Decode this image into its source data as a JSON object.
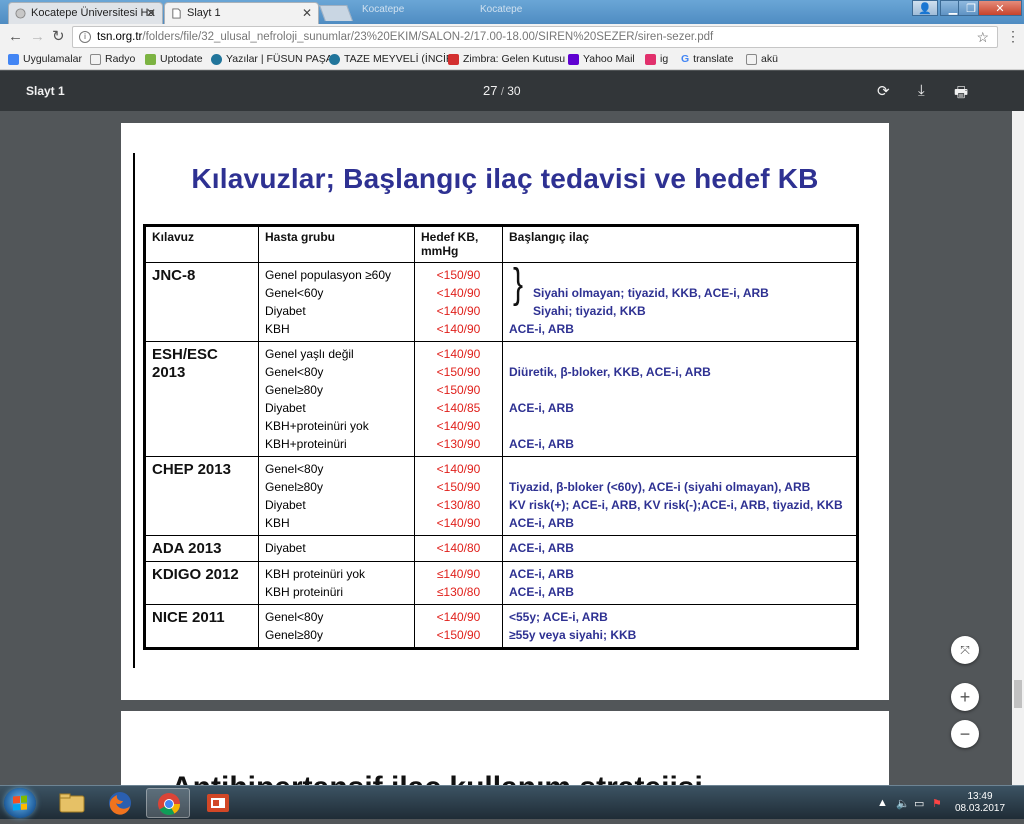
{
  "browser": {
    "tabs": [
      {
        "title": "Kocatepe Üniversitesi Ha",
        "active": false
      },
      {
        "title": "Slayt 1",
        "active": true
      }
    ],
    "blurred_tabs": [
      "Kocatepe",
      "Kocatepe"
    ],
    "url_host": "tsn.org.tr",
    "url_path": "/folders/file/32_ulusal_nefroloji_sunumlar/23%20EKIM/SALON-2/17.00-18.00/SIREN%20SEZER/siren-sezer.pdf",
    "bookmarks": [
      {
        "label": "Uygulamalar",
        "icon": "apps-grid-icon",
        "color": "#4285f4"
      },
      {
        "label": "Radyo",
        "icon": "page-icon",
        "color": "#888888"
      },
      {
        "label": "Uptodate",
        "icon": "uptodate-icon",
        "color": "#7cb342"
      },
      {
        "label": "Yazılar | FÜSUN PAŞA",
        "icon": "wordpress-icon",
        "color": "#21759b"
      },
      {
        "label": "TAZE MEYVELİ (İNCİR",
        "icon": "wordpress-icon",
        "color": "#21759b"
      },
      {
        "label": "Zimbra: Gelen Kutusu",
        "icon": "zimbra-icon",
        "color": "#d32f2f"
      },
      {
        "label": "Yahoo Mail",
        "icon": "yahoo-mail-icon",
        "color": "#5f01d1"
      },
      {
        "label": "ig",
        "icon": "instagram-icon",
        "color": "#e1306c"
      },
      {
        "label": "translate",
        "icon": "google-icon",
        "color": "#4285f4"
      },
      {
        "label": "akü",
        "icon": "page-icon",
        "color": "#888888"
      }
    ]
  },
  "pdf": {
    "title": "Slayt 1",
    "current_page": "27",
    "page_separator": "/",
    "total_pages": "30"
  },
  "slide": {
    "title": "Kılavuzlar; Başlangıç ilaç tedavisi ve hedef KB",
    "headers": [
      "Kılavuz",
      "Hasta grubu",
      "Hedef KB, mmHg",
      "Başlangıç ilaç"
    ],
    "groups": [
      {
        "name": [
          "JNC-8"
        ],
        "patients": [
          "Genel populasyon ≥60y",
          "Genel<60y",
          "Diyabet",
          "KBH"
        ],
        "targets": [
          "<150/90",
          "<140/90",
          "<140/90",
          "<140/90"
        ],
        "drugs": [
          "",
          "Siyahi olmayan; tiyazid, KKB, ACE-i, ARB",
          "Siyahi; tiyazid, KKB",
          "ACE-i, ARB"
        ]
      },
      {
        "name": [
          "ESH/ESC",
          "2013"
        ],
        "patients": [
          "Genel yaşlı değil",
          "Genel<80y",
          "Genel≥80y",
          "Diyabet",
          "KBH+proteinüri yok",
          "KBH+proteinüri"
        ],
        "targets": [
          "<140/90",
          "<150/90",
          "<150/90",
          "<140/85",
          "<140/90",
          "<130/90"
        ],
        "drugs": [
          "",
          "Diüretik, β-bloker, KKB, ACE-i, ARB",
          "",
          "ACE-i, ARB",
          "",
          "ACE-i, ARB"
        ]
      },
      {
        "name": [
          "CHEP 2013"
        ],
        "patients": [
          "Genel<80y",
          "Genel≥80y",
          "Diyabet",
          "KBH"
        ],
        "targets": [
          "<140/90",
          "<150/90",
          "<130/80",
          "<140/90"
        ],
        "drugs": [
          "",
          "Tiyazid, β-bloker (<60y), ACE-i (siyahi olmayan), ARB",
          "KV risk(+); ACE-i, ARB, KV risk(-);ACE-i, ARB, tiyazid, KKB",
          "ACE-i, ARB"
        ]
      },
      {
        "name": [
          "ADA 2013"
        ],
        "patients": [
          "Diyabet"
        ],
        "targets": [
          "<140/80"
        ],
        "drugs": [
          "ACE-i, ARB"
        ]
      },
      {
        "name": [
          "KDIGO 2012"
        ],
        "patients": [
          "KBH proteinüri yok",
          "KBH proteinüri"
        ],
        "targets": [
          "≤140/90",
          "≤130/80"
        ],
        "drugs": [
          "ACE-i, ARB",
          "ACE-i, ARB"
        ]
      },
      {
        "name": [
          "NICE 2011"
        ],
        "patients": [
          "Genel<80y",
          "Genel≥80y"
        ],
        "targets": [
          "<140/90",
          "<150/90"
        ],
        "drugs": [
          "<55y; ACE-i, ARB",
          "≥55y veya siyahi; KKB"
        ]
      }
    ],
    "brace_symbol": "}"
  },
  "next_slide": {
    "title_partial": "Antihipertansif ilaç kullanım stratejisi"
  },
  "zoom": {
    "fit_icon": "fit-to-page-icon",
    "zoom_in": "+",
    "zoom_out": "−"
  },
  "taskbar": {
    "apps": [
      "windows-explorer-icon",
      "firefox-icon",
      "chrome-icon",
      "pdf-presentation-icon"
    ],
    "time": "13:49",
    "date": "08.03.2017"
  }
}
